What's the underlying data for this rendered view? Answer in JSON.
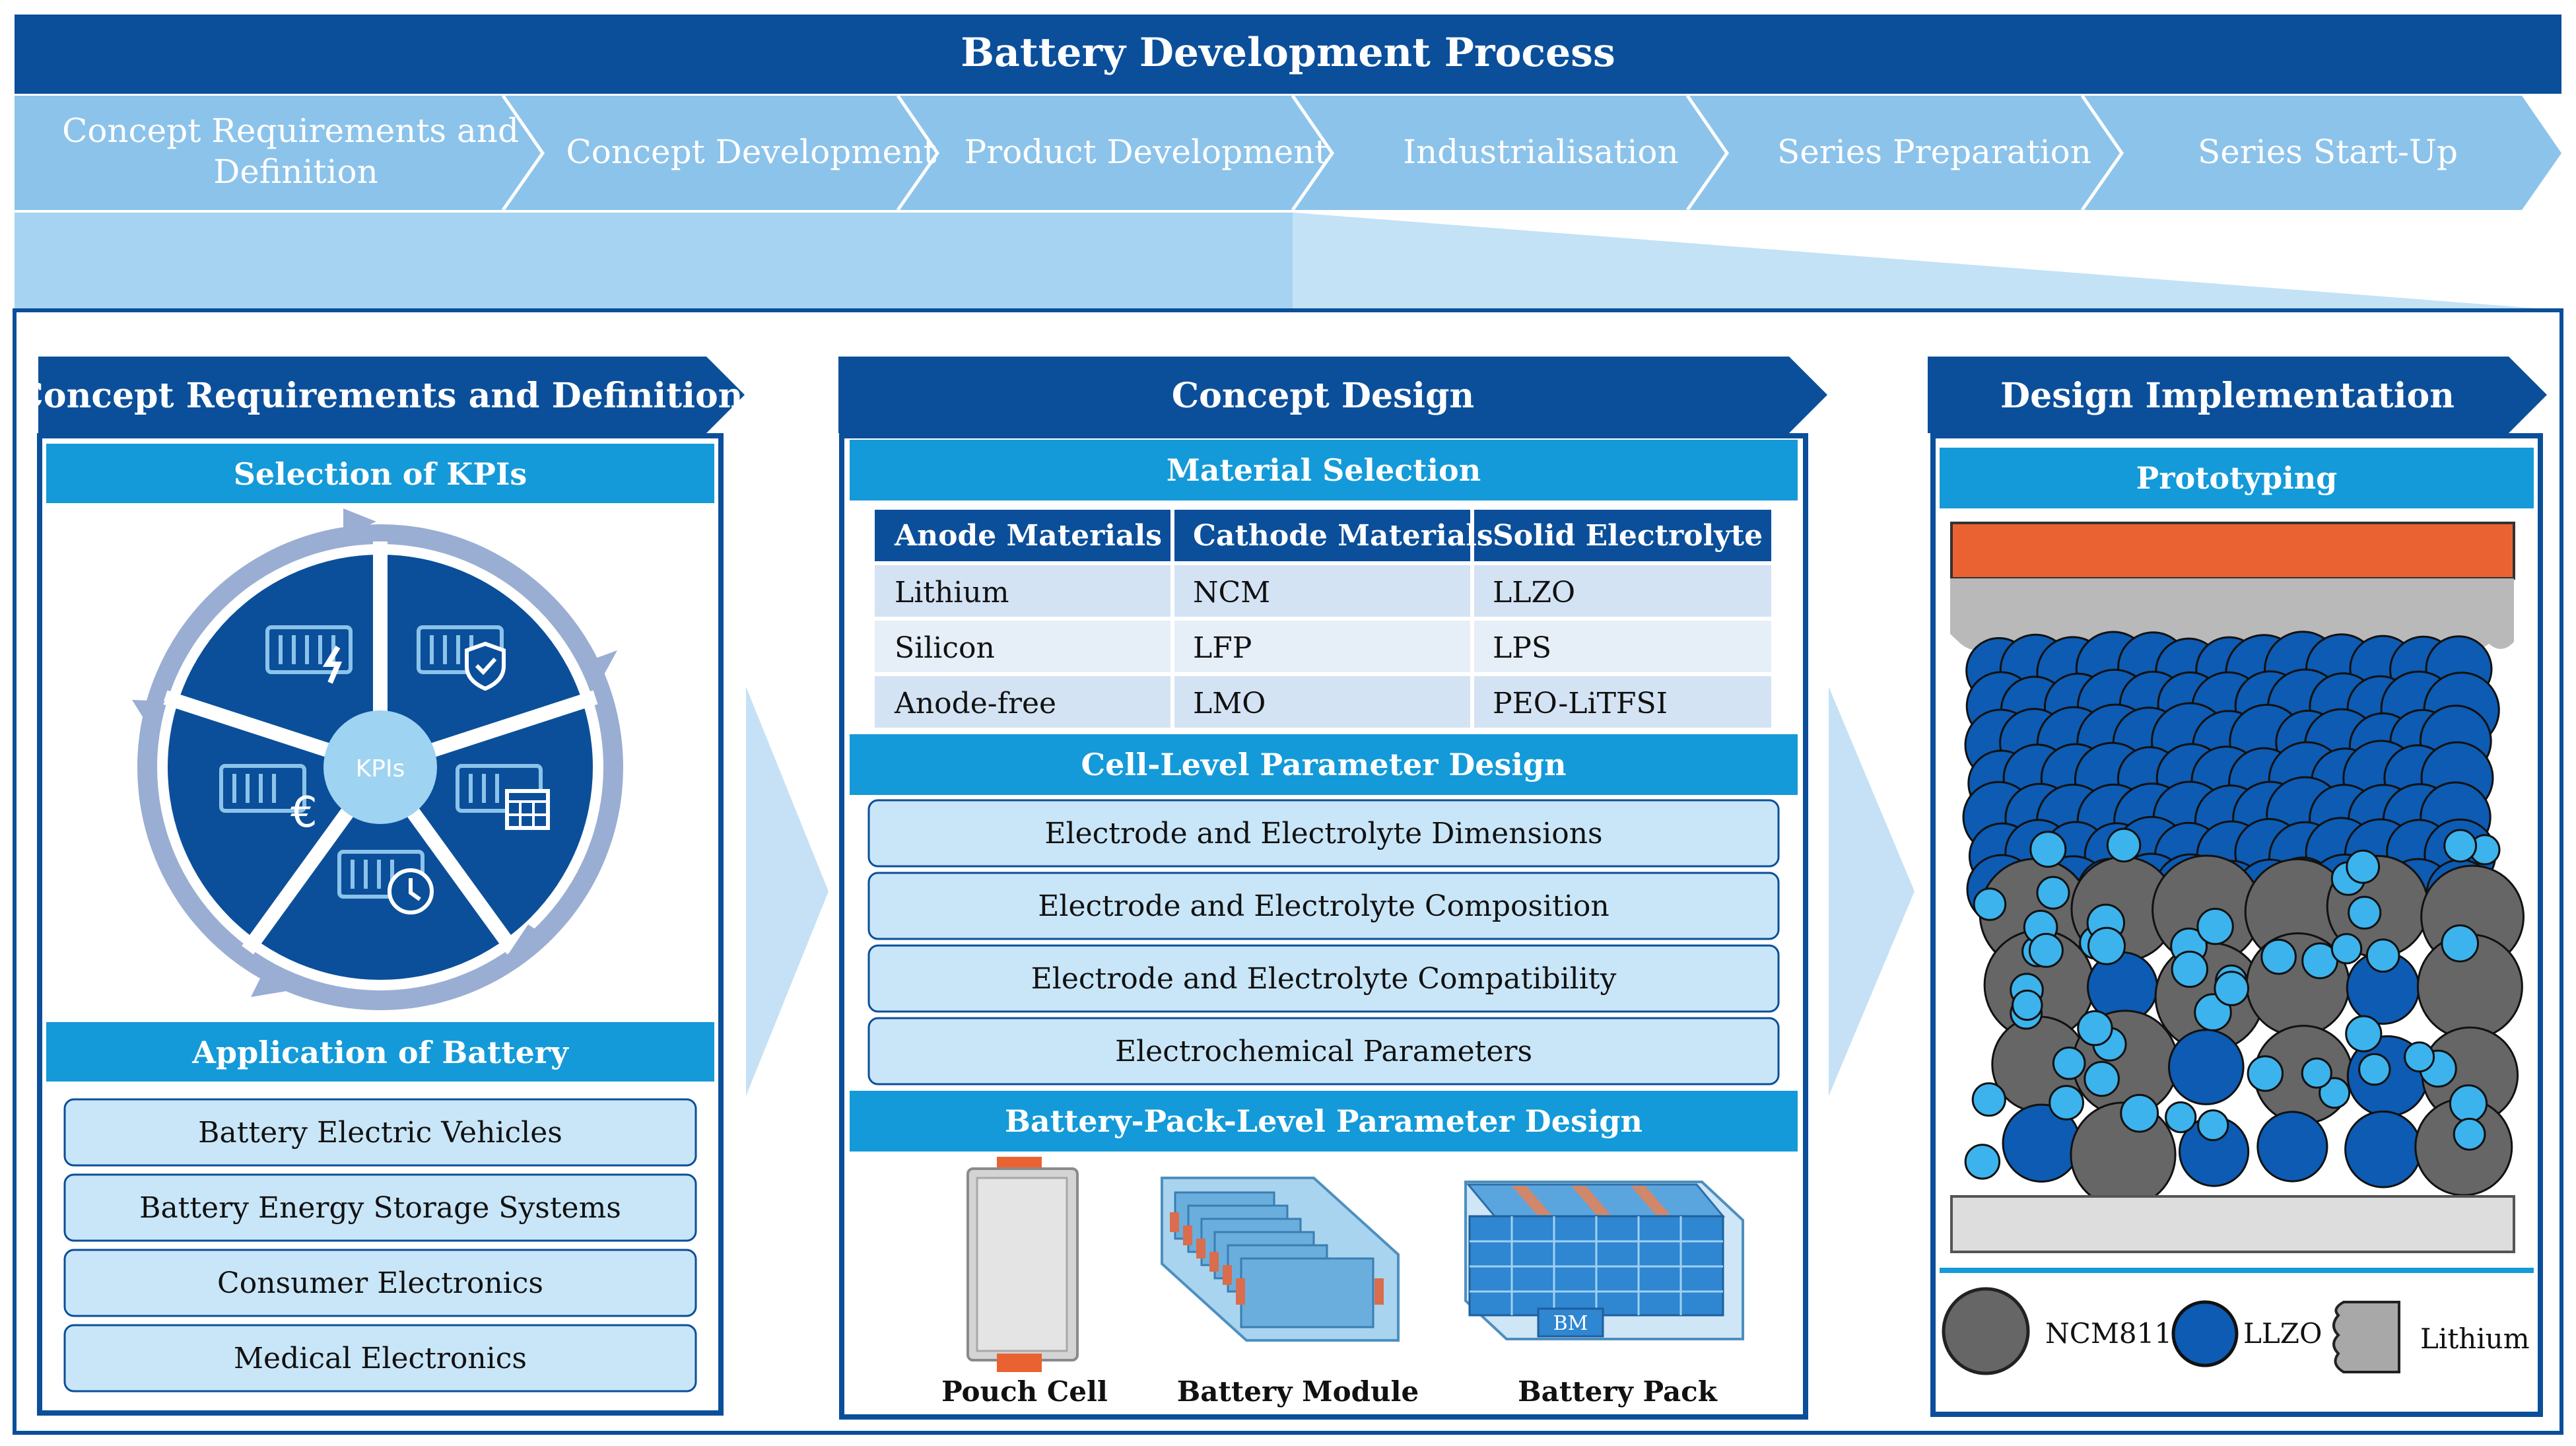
{
  "title": "Battery Development Process",
  "phases": [
    "Concept Requirements and Definition",
    "Concept Development",
    "Product Development",
    "Industrialisation",
    "Series Preparation",
    "Series Start-Up"
  ],
  "panels": {
    "left": {
      "title": "Concept Requirements and Definition",
      "kpi_header": "Selection of KPIs",
      "kpi_center": "KPIs",
      "application_header": "Application of Battery",
      "applications": [
        "Battery Electric Vehicles",
        "Battery Energy Storage Systems",
        "Consumer Electronics",
        "Medical Electronics"
      ]
    },
    "middle": {
      "title": "Concept Design",
      "material_header": "Material Selection",
      "table_headers": [
        "Anode Materials",
        "Cathode Materials",
        "Solid Electrolyte"
      ],
      "table_rows": [
        [
          "Lithium",
          "NCM",
          "LLZO"
        ],
        [
          "Silicon",
          "LFP",
          "LPS"
        ],
        [
          "Anode-free",
          "LMO",
          "PEO-LiTFSI"
        ]
      ],
      "cell_header": "Cell-Level Parameter Design",
      "cell_params": [
        "Electrode and Electrolyte Dimensions",
        "Electrode and Electrolyte Composition",
        "Electrode and Electrolyte Compatibility",
        "Electrochemical Parameters"
      ],
      "pack_header": "Battery-Pack-Level Parameter Design",
      "pack_items": [
        "Pouch Cell",
        "Battery Module",
        "Battery Pack"
      ],
      "bm_label": "BM"
    },
    "right": {
      "title": "Design Implementation",
      "proto_header": "Prototyping",
      "legend": [
        "NCM811",
        "LLZO",
        "Lithium"
      ]
    }
  },
  "colors": {
    "dark_blue": "#0b4f9a",
    "mid_blue": "#149ad8",
    "light_blue": "#c9e6f8",
    "phase_bar": "#8cc3ea",
    "orange": "#ea6231",
    "gray_particle": "#666666",
    "llzo_dark": "#0d5bb2",
    "llzo_light": "#3cb3ec"
  }
}
